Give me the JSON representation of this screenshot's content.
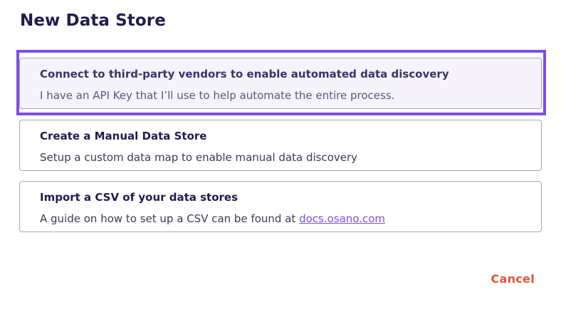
{
  "dialog": {
    "title": "New Data Store"
  },
  "options": [
    {
      "title": "Connect to third-party vendors to enable automated data discovery",
      "description": "I have an API Key that I’ll use to help automate the entire process."
    },
    {
      "title": "Create a Manual Data Store",
      "description": "Setup a custom data map to enable manual data discovery"
    },
    {
      "title": "Import a CSV of your data stores",
      "description": "A guide on how to set up a CSV can be found at ",
      "link": "docs.osano.com"
    }
  ],
  "footer": {
    "cancel_label": "Cancel"
  },
  "colors": {
    "accent": "#7d4ee6",
    "title": "#1f1d4d",
    "cancel": "#e2543a"
  }
}
